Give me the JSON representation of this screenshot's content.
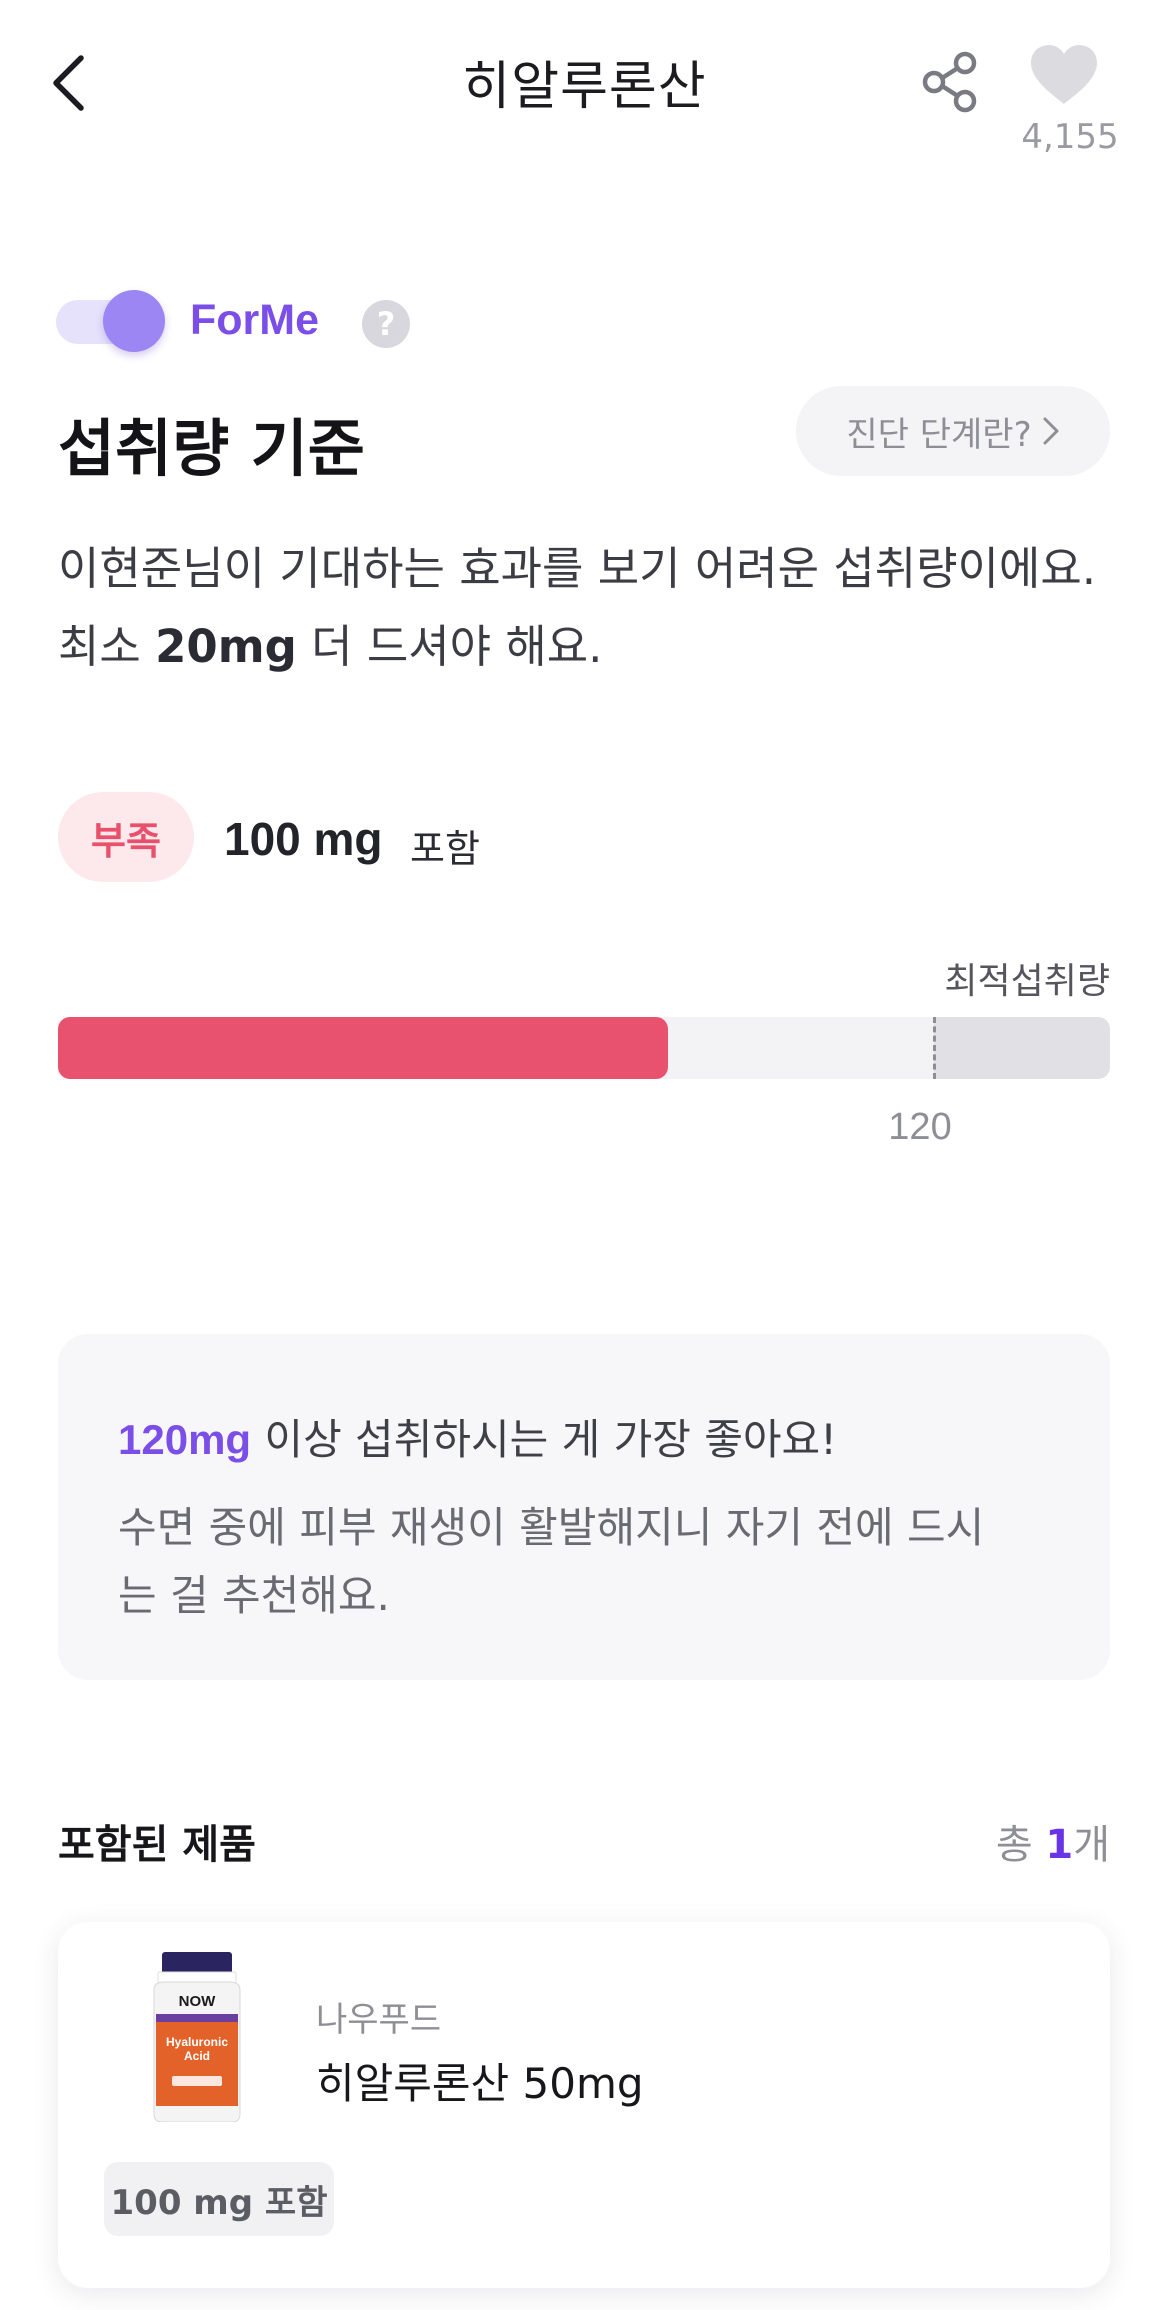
{
  "header": {
    "title": "히알루론산",
    "like_count": "4,155",
    "back_icon": "chevron-left-icon",
    "share_icon": "share-icon",
    "like_icon": "heart-icon"
  },
  "forme": {
    "toggle_on": true,
    "label": "ForMe",
    "help_glyph": "?"
  },
  "section": {
    "title": "섭취량 기준",
    "stage_button": "진단 단계란?",
    "description_prefix": "이현준님이 기대하는 효과를 보기 어려운 섭취량이에요. 최소 ",
    "description_highlight": "20mg",
    "description_suffix": " 더 드셔야 해요."
  },
  "status": {
    "badge": "부족",
    "amount": "100 mg",
    "amount_suffix": "포함",
    "badge_color": "#e8506b"
  },
  "chart_data": {
    "type": "bar",
    "optimal_label": "최적섭취량",
    "current_value": 100,
    "optimal_value": 120,
    "marker_label": "120",
    "fill_color": "#e8526f"
  },
  "recommendation": {
    "accent": "120mg",
    "line1_rest": " 이상 섭취하시는 게 가장 좋아요!",
    "line2": "수면 중에 피부 재생이 활발해지니 자기 전에 드시는 걸 추천해요.",
    "accent_color": "#7b4ee8"
  },
  "products": {
    "title": "포함된 제품",
    "count_prefix": "총 ",
    "count": "1",
    "count_suffix": "개",
    "items": [
      {
        "brand": "나우푸드",
        "name": "히알루론산 50mg",
        "tag": "100 mg 포함",
        "bottle_brand": "NOW",
        "bottle_line1": "Hyaluronic",
        "bottle_line2": "Acid"
      }
    ]
  }
}
